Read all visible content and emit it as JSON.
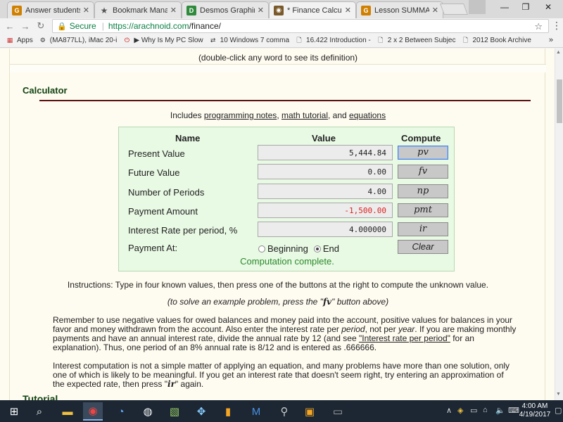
{
  "browser": {
    "tabs": [
      {
        "title": "Answer students'",
        "favicon": "mcgraw-icon",
        "active": false
      },
      {
        "title": "Bookmark Manag",
        "favicon": "star-icon",
        "active": false
      },
      {
        "title": "Desmos Graphing",
        "favicon": "desmos-icon",
        "active": false
      },
      {
        "title": "* Finance Calculat",
        "favicon": "arachnoid-icon",
        "active": true
      },
      {
        "title": "Lesson SUMMAR",
        "favicon": "mcgraw-icon",
        "active": false
      }
    ],
    "secure_label": "Secure",
    "url_host": "https://arachnoid.com",
    "url_path": "/finance/",
    "bookmarks": [
      {
        "label": "Apps"
      },
      {
        "label": "(MA877LL), iMac 20-i"
      },
      {
        "label": "▶ Why Is My PC Slow"
      },
      {
        "label": "10 Windows 7 comma"
      },
      {
        "label": "16.422 Introduction -"
      },
      {
        "label": "2 x 2 Between Subjec"
      },
      {
        "label": "2012 Book Archive"
      }
    ],
    "bookmarks_more": "»"
  },
  "page": {
    "dblclick_hint": "(double-click any word to see its definition)",
    "section_title": "Calculator",
    "includes_prefix": "Includes ",
    "includes_link1": "programming notes",
    "includes_sep1": ", ",
    "includes_link2": "math tutorial",
    "includes_sep2": ", and ",
    "includes_link3": "equations",
    "calculator": {
      "headers": {
        "name": "Name",
        "value": "Value",
        "compute": "Compute"
      },
      "rows": [
        {
          "label": "Present Value",
          "value": "5,444.84",
          "button": "pv"
        },
        {
          "label": "Future Value",
          "value": "0.00",
          "button": "fv"
        },
        {
          "label": "Number of Periods",
          "value": "4.00",
          "button": "np"
        },
        {
          "label": "Payment Amount",
          "value": "-1,500.00",
          "button": "pmt"
        },
        {
          "label": "Interest Rate per period, %",
          "value": "4.000000",
          "button": "ir"
        }
      ],
      "payment_at_label": "Payment At:",
      "option_beginning": "Beginning",
      "option_end": "End",
      "clear_label": "Clear",
      "status": "Computation complete."
    },
    "instructions": "Instructions: Type in four known values, then press one of the buttons at the right to compute the unknown value.",
    "example_prefix": "(to solve an example problem, press the \"",
    "example_button": "fv",
    "example_suffix": "\" button above)",
    "para1_a": "Remember to use negative values for owed balances and money paid into the account, positive values for balances in your favor and money withdrawn from the account. Also enter the interest rate per ",
    "para1_period": "period",
    "para1_b": ", not per ",
    "para1_year": "year",
    "para1_c": ". If you are making monthly payments and have an annual interest rate, divide the annual rate by 12 (and see ",
    "para1_link": "\"Interest rate per period\"",
    "para1_d": " for an explanation). Thus, one period of an 8% annual rate is 8/12 and is entered as .666666.",
    "para2_a": "Interest computation is not a simple matter of applying an equation, and many problems have more than one solution, only one of which is likely to be meaningful. If you get an interest rate that doesn't seem right, try entering an approximation of the expected rate, then press \"",
    "para2_ir": "ir",
    "para2_b": "\" again.",
    "tutorial_heading": "Tutorial"
  },
  "taskbar": {
    "time": "4:00 AM",
    "date": "4/19/2017"
  }
}
